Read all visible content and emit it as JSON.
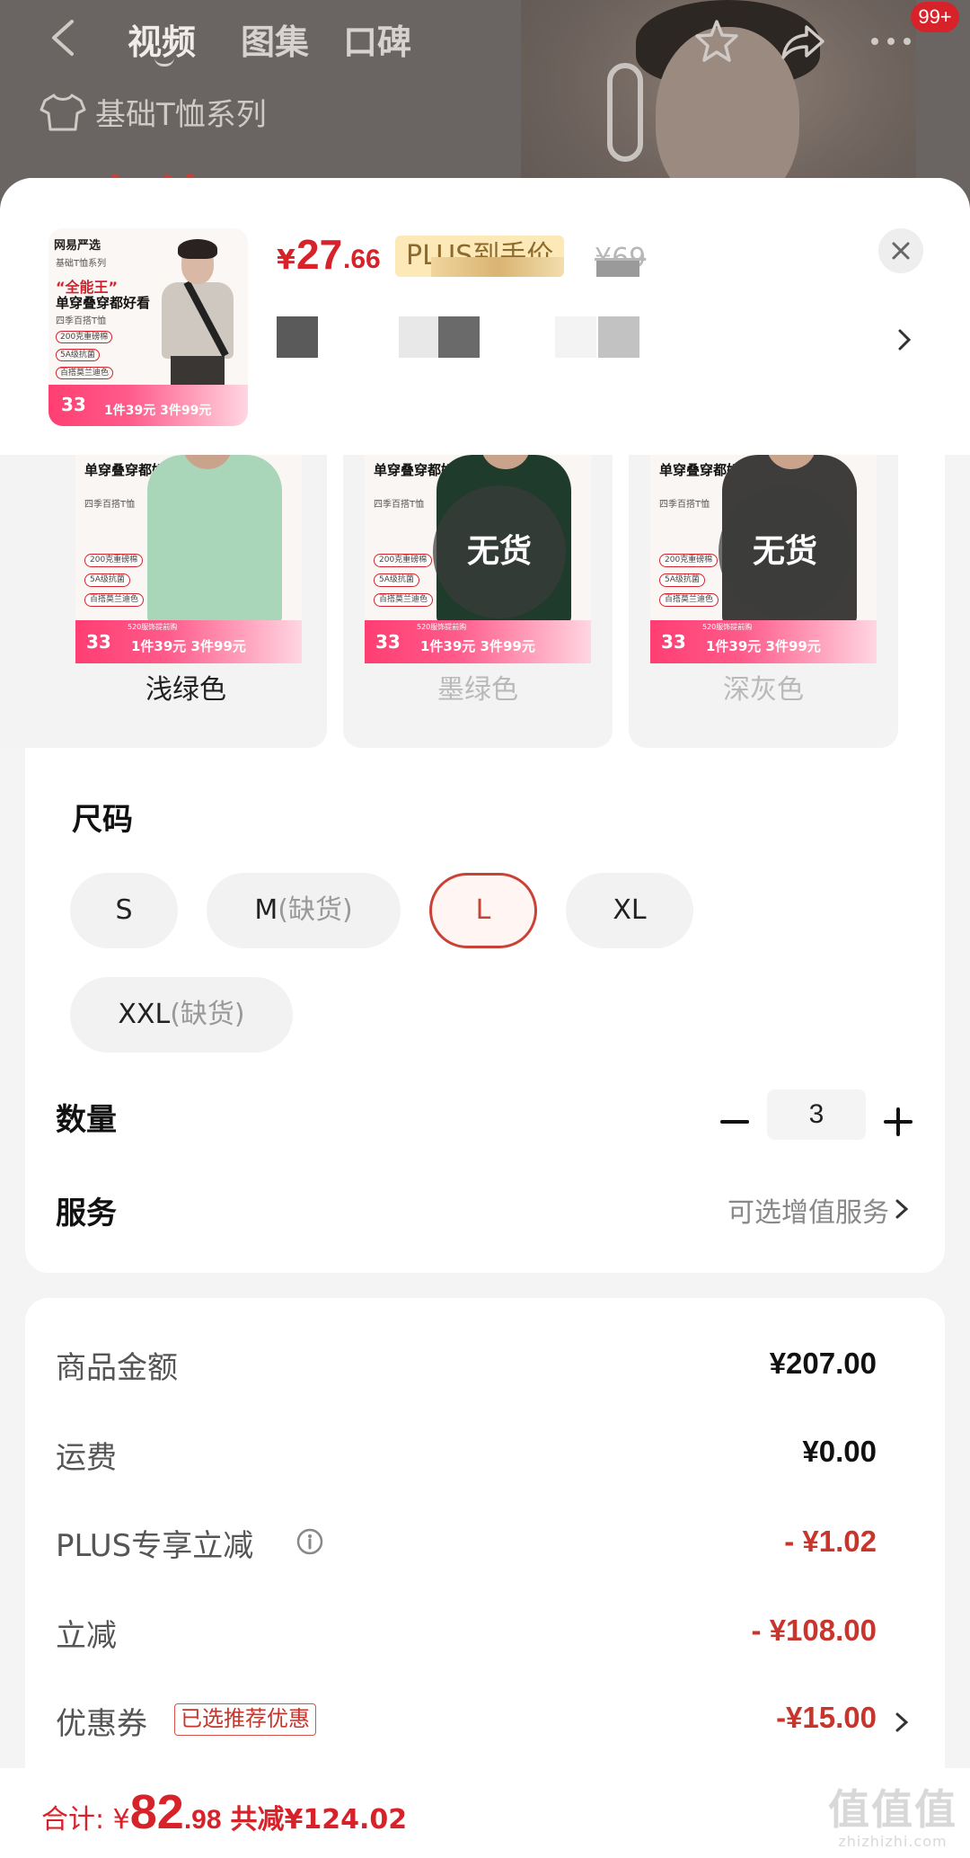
{
  "topbar": {
    "tabs": [
      "视频",
      "图集",
      "口碑"
    ],
    "badge": "99+",
    "series": "基础T恤系列",
    "slogan": "“全能王”"
  },
  "product": {
    "thumb": {
      "brand": "网易严选",
      "series_line": "基础T恤系列",
      "slogan": "“全能王”",
      "slogan2": "单穿叠穿都好看",
      "sub": "四季百搭T恤",
      "features": [
        "200克重磅棉",
        "5A级抗菌",
        "百搭莫兰迪色"
      ],
      "promo_big": "33",
      "promo_text": "1件39元 3件99元"
    },
    "price_currency": "¥",
    "price_int": "27",
    "price_dec": ".66",
    "plus_tag": "PLUS到手价",
    "orig_price": "¥69"
  },
  "colors": {
    "items": [
      {
        "label": "浅绿色",
        "sold_out": false,
        "shirt_color": "#a9d6b8"
      },
      {
        "label": "墨绿色",
        "sold_out": true,
        "shirt_color": "#1f3b2b"
      },
      {
        "label": "深灰色",
        "sold_out": true,
        "shirt_color": "#3f3d3c"
      }
    ],
    "sold_out_text": "无货",
    "card_slogan": "单穿叠穿都好看",
    "card_sub": "四季百搭T恤",
    "card_features": [
      "200克重磅棉",
      "5A级抗菌",
      "百搭莫兰迪色"
    ],
    "card_promo_big": "33",
    "card_promo_text": "1件39元 3件99元",
    "card_promo_top": "520服饰提前购"
  },
  "size": {
    "title": "尺码",
    "options": [
      {
        "name": "S",
        "note": ""
      },
      {
        "name": "M",
        "note": "(缺货)"
      },
      {
        "name": "L",
        "note": ""
      },
      {
        "name": "XL",
        "note": ""
      },
      {
        "name": "XXL",
        "note": "(缺货)"
      }
    ],
    "selected": "L"
  },
  "quantity": {
    "title": "数量",
    "value": "3"
  },
  "service": {
    "title": "服务",
    "text": "可选增值服务"
  },
  "summary": {
    "goods_label": "商品金额",
    "goods_value": "¥207.00",
    "shipping_label": "运费",
    "shipping_value": "¥0.00",
    "plus_label": "PLUS专享立减",
    "plus_value": "- ¥1.02",
    "discount_label": "立减",
    "discount_value": "- ¥108.00",
    "coupon_label": "优惠券",
    "coupon_tag": "已选推荐优惠",
    "coupon_value": "-¥15.00"
  },
  "bottom": {
    "total_label": "合计: ¥",
    "total_int": "82",
    "total_dec": ".98",
    "total_save": "共减¥124.02",
    "watermark": "值值值",
    "watermark_url": "zhizhizhi.com"
  },
  "colors_theme": {
    "accent": "#d8222a",
    "selected_border": "#c94236"
  }
}
